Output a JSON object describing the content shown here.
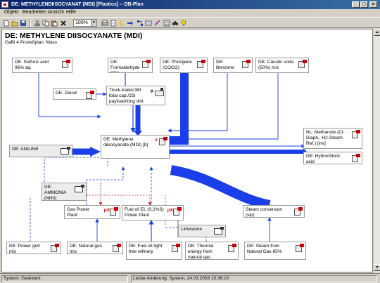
{
  "window": {
    "title": "DE: METHYLENDIISOCYANAT (MDI) [Plastics] -- DB-Plan",
    "minimize": "_",
    "maximize": "□",
    "close": "×"
  },
  "menu": [
    "Objekt",
    "Bearbeiten",
    "Ansicht",
    "Hilfe"
  ],
  "toolbar": {
    "zoom_value": "100%"
  },
  "plan": {
    "title": "DE: METHYLENE DIISOCYANATE (MDI)",
    "subtitle": "GaBi 4 Prozeßplan: Mass"
  },
  "nodes": {
    "sulfuric": "DE: Sulfuric acid 96% aq.",
    "formaldehyde": "DE: Formaldehyde 37%",
    "phosgene": "DE: Phosgene (COCl2)",
    "benzene": "DE: Benzene",
    "caustic": "DE: Caustic soda (50%) mix",
    "diesel": "DE: Diesel",
    "truck": "Truck-trailer/38t total cap./25t payload/long dist",
    "truck_flags": "p",
    "aniline": "DE: ANILINE",
    "mdi": "DE: Methylene diisocyanate (MDI) [b]",
    "mdi_flags": "x",
    "methanol": "NL: Methanole (Cl-Diaph., H2-Steam-Ref.) [inv]",
    "hcl": "DE: Hydrochloric acid",
    "ammonia": "DE: AMMONIA (NH3)",
    "gas_power": "Gas Power Plant",
    "gas_power_flags": "pX",
    "fuel_oil_power": "Fuel oil EL (0,2%S) Power Plant",
    "fuel_oil_power_flags": "pX",
    "limestone": "Limestone",
    "steam_conv": "Steam conversion (slp)",
    "power_grid": "DE: Power grid mix",
    "natural_gas": "DE: Natural gas mix",
    "fuel_oil_light": "DE: Fuel oil light free refinery",
    "thermal": "DE: Thermal energy from natural gas",
    "steam_nat": "DE: Steam from Natural Gas 85%"
  },
  "status": {
    "left": "System: Geändert.",
    "right": "Letzte Änderung: System, 24.03.2003 10:36:10"
  },
  "colors": {
    "flow_blue": "#1a3fe8",
    "link_red": "#e02020",
    "title_bar": "#0a246a"
  }
}
